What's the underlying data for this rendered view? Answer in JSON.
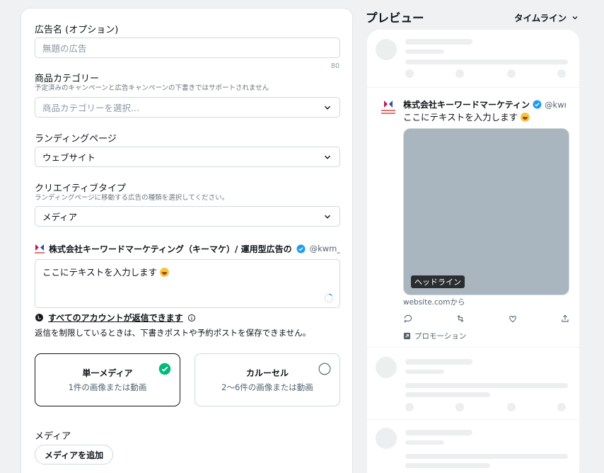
{
  "form": {
    "ad_name_label": "広告名 (オプション)",
    "ad_name_placeholder": "無題の広告",
    "ad_name_counter": "80",
    "category_label": "商品カテゴリー",
    "category_sub": "予定済みのキャンペーンと広告キャンペーンの下書きではサポートされません",
    "category_placeholder": "商品カテゴリーを選択...",
    "landing_label": "ランディングページ",
    "landing_value": "ウェブサイト",
    "creative_label": "クリエイティブタイプ",
    "creative_sub": "ランディングページに移動する広告の種類を選択してください。",
    "creative_value": "メディア",
    "account_name": "株式会社キーワードマーケティング（キーマケ）/ 運用型広告の",
    "account_handle": "@kwm_co",
    "tweet_text": "ここにテキストを入力します",
    "reply_setting": "すべてのアカウントが返信できます",
    "reply_note": "返信を制限しているときは、下書きポストや予約ポストを保存できません。",
    "single_media_title": "単一メディア",
    "single_media_desc": "1件の画像または動画",
    "carousel_title": "カルーセル",
    "carousel_desc": "2〜6件の画像または動画",
    "media_label": "メディア",
    "add_media_button": "メディアを追加"
  },
  "preview": {
    "title": "プレビュー",
    "view_select": "タイムライン",
    "tweet_name": "株式会社キーワードマーケティン",
    "tweet_handle": "@kwm",
    "tweet_text": "ここにテキストを入力します",
    "headline": "ヘッドライン",
    "url": "website.comから",
    "promotion": "プロモーション"
  },
  "colors": {
    "accent_blue": "#1d9bf0",
    "check_green": "#00ba7c",
    "media_placeholder": "#a9b6c0"
  },
  "icons": [
    "chevron-down-icon",
    "verified-badge-icon",
    "check-circle-icon",
    "radio-empty-icon",
    "reply-icon",
    "retweet-icon",
    "like-icon",
    "share-icon",
    "promoted-icon",
    "globe-icon",
    "info-icon"
  ]
}
